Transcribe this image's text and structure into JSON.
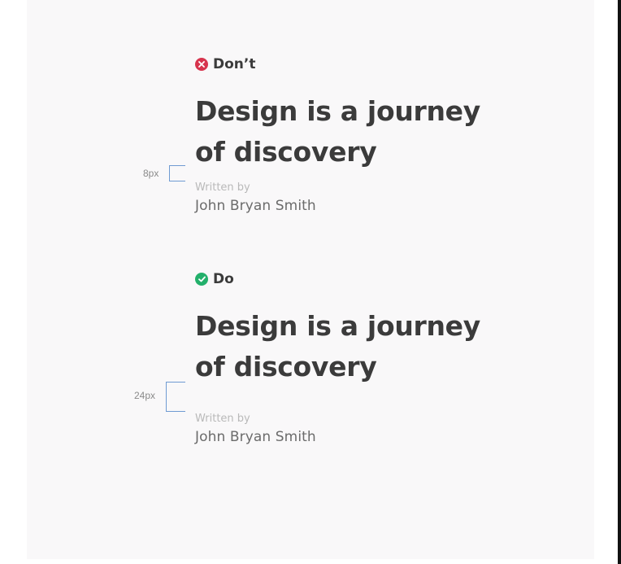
{
  "examples": [
    {
      "kind": "dont",
      "label": "Don’t",
      "icon": "x-circle-icon",
      "icon_color": "#d7344d",
      "headline_line1": "Design is a journey",
      "headline_line2": "of discovery",
      "written_by": "Written by",
      "author": "John Bryan Smith",
      "spacing": "8px"
    },
    {
      "kind": "do",
      "label": "Do",
      "icon": "check-circle-icon",
      "icon_color": "#23b06b",
      "headline_line1": "Design is a journey",
      "headline_line2": "of discovery",
      "written_by": "Written by",
      "author": "John Bryan Smith",
      "spacing": "24px"
    }
  ],
  "colors": {
    "background": "#f9f8f9",
    "text_primary": "#3b3b3b",
    "text_secondary": "#6b6b6b",
    "text_muted": "#b9b9b9",
    "bracket": "#6f9bd2"
  }
}
